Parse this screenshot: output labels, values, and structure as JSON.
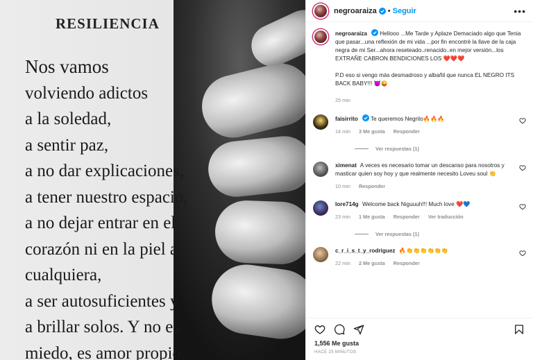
{
  "image": {
    "title": "RESILIENCIA",
    "lines": [
      "Nos vamos",
      "volviendo adictos",
      "a la soledad,",
      "a sentir paz,",
      "a no dar explicaciones,",
      "a tener nuestro espacio,",
      "a no dejar entrar en el",
      "corazón ni en la piel a",
      "cualquiera,",
      "a ser autosuficientes y",
      "a brillar solos. Y no es",
      "miedo, es amor propio."
    ]
  },
  "header": {
    "username": "negroaraiza",
    "separator": "•",
    "follow_label": "Seguir",
    "more_label": "•••"
  },
  "caption": {
    "username": "negroaraiza",
    "text": "Hellooo ...Me Tarde y Aplaze Demaciado algo que Tenia que pasar...una reflexión de mi vida ...por fin encontrè la llave de la caja negra de mi Ser...ahora reseteado..renacido..en mejor versión...los EXTRAÑE CABRON BENDICIONES LOS ❤️❤️❤️",
    "text2": "P.D eso si vengo más desmadroso y albañil que nunca EL NEGRO ITS BACK BABY!!! 😈😜",
    "time": "25 min"
  },
  "comments": [
    {
      "user": "faisirrito",
      "text": "Te queremos Negrito🔥🔥🔥",
      "time": "14 min",
      "likes": "3 Me gusta",
      "reply": "Responder",
      "translate": "",
      "replies": "Ver respuestas (1)"
    },
    {
      "user": "ximenat",
      "text": "A veces es necesario tomar un descanso para nosotros y masticar quien soy hoy y que realmente necesito Loveu soul 👏",
      "time": "10 min",
      "likes": "",
      "reply": "Responder",
      "translate": "",
      "replies": ""
    },
    {
      "user": "lore714g",
      "text": "Welcome back Niguuuh!!! Much love ❤️💙",
      "time": "23 min",
      "likes": "1 Me gusta",
      "reply": "Responder",
      "translate": "Ver traducción",
      "replies": "Ver respuestas (1)"
    },
    {
      "user": "c_r_i_s_t_y_rodriguez",
      "text": "🔥👏👏👏👏👏👏",
      "time": "22 min",
      "likes": "2 Me gusta",
      "reply": "Responder",
      "translate": "",
      "replies": ""
    }
  ],
  "footer": {
    "likes": "1,556 Me gusta",
    "time_ago": "HACE 25 MINUTOS"
  },
  "colors": {
    "accent": "#0095f6",
    "heart": "#ed4956",
    "muted": "#8e8e8e"
  }
}
